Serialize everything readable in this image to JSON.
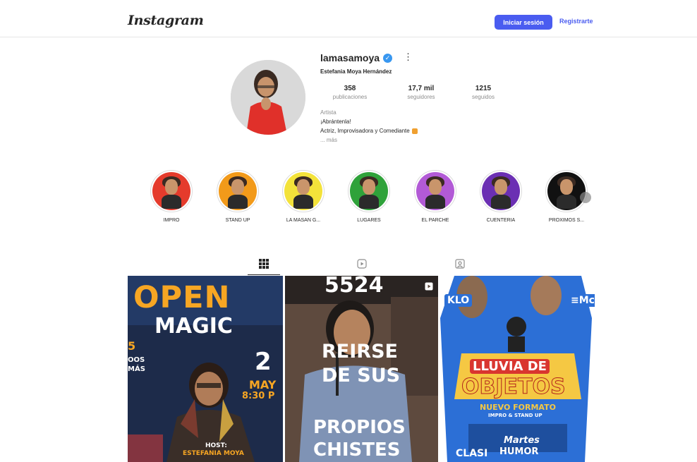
{
  "header": {
    "logo": "Instagram",
    "login_label": "Iniciar sesión",
    "register_label": "Registrarte",
    "accent_color": "#4a5cf0"
  },
  "profile": {
    "username": "lamasamoya",
    "verified": true,
    "full_name": "Estefania Moya Hernández",
    "stats": [
      {
        "value": "358",
        "label": "publicaciones"
      },
      {
        "value": "17,7 mil",
        "label": "seguidores"
      },
      {
        "value": "1215",
        "label": "seguidos"
      }
    ],
    "category": "Artista",
    "bio_lines": [
      "¡Abrántenla!",
      "Actriz, Improvisadora y Comediante"
    ],
    "more_label": "... más"
  },
  "highlights": [
    {
      "label": "IMPRO",
      "color": "#e53b2c"
    },
    {
      "label": "STAND UP",
      "color": "#f29a1a"
    },
    {
      "label": "LA MASAN G...",
      "color": "#f3e23a"
    },
    {
      "label": "LUGARES",
      "color": "#2fa23a"
    },
    {
      "label": "EL PARCHE",
      "color": "#b25ad6"
    },
    {
      "label": "CUENTERIA",
      "color": "#6b2fb3"
    },
    {
      "label": "PROXIMOS S...",
      "color": "#111111"
    }
  ],
  "tabs": [
    {
      "icon": "grid-icon",
      "active": true
    },
    {
      "icon": "reels-icon",
      "active": false
    },
    {
      "icon": "tagged-icon",
      "active": false
    }
  ],
  "posts": [
    {
      "title_1": "OPEN",
      "title_2": "MAGIC",
      "number": "2",
      "date": "MAY",
      "time": "8:30 P",
      "host_label": "HOST:",
      "host_name": "ESTEFANIA MOYA",
      "side_text_1": "5",
      "side_text_2": "OOS",
      "side_text_3": "MÁS"
    },
    {
      "top_text": "5524",
      "text_1": "REIRSE",
      "text_2": "DE SUS",
      "text_3": "PROPIOS",
      "text_4": "CHISTES",
      "reel_icon": "reel-icon"
    },
    {
      "badge_left": "KLO",
      "badge_right": "≡Mc",
      "title_1": "LLUVIA DE",
      "title_2": "OBJETOS",
      "subtitle": "NUEVO FORMATO",
      "subtitle_2": "IMPRO & STAND UP",
      "footer_1": "Martes",
      "footer_2": "HUMOR",
      "footer_left": "CLASI"
    }
  ]
}
